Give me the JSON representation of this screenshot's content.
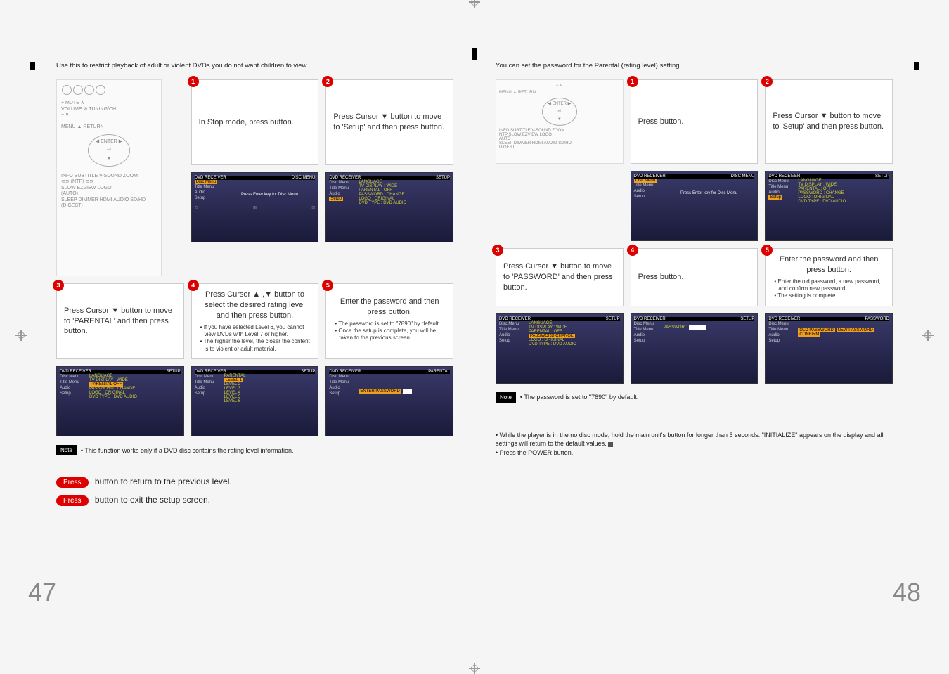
{
  "crosshair_glyph": "⊕",
  "left_page": {
    "intro": "Use this to restrict playback of adult or violent DVDs you do not want children to view.",
    "remote_labels": [
      "MUTE",
      "VOLUME",
      "TUNING/CH",
      "MENU",
      "ENTER",
      "RETURN",
      "INFO",
      "SUBTITLE",
      "V-SOUND",
      "ZOOM",
      "NTP",
      "SLOW",
      "EZVIEW",
      "LOGO",
      "AUTO",
      "SLEEP",
      "DIMMER",
      "HDMI AUDIO",
      "SD/HD",
      "DIGEST"
    ],
    "step1": "In Stop mode, press         button.",
    "step2": "Press Cursor ▼ button to move to 'Setup' and then press          button.",
    "step3": "Press Cursor ▼ button to move to 'PARENTAL' and then press          button.",
    "step4": "Press Cursor ▲ ,▼ button to select the desired rating level and then press           button.",
    "step4_notes": [
      "If you have selected Level 6, you cannot view DVDs with Level 7 or higher.",
      "The higher the level, the closer the content is to violent or adult material."
    ],
    "step5": "Enter the password and then press           button.",
    "step5_notes": [
      "The password is set to \"7890\" by default.",
      "Once the setup is complete, you will be taken to the previous screen."
    ],
    "osd_sidebar": [
      "Disc Menu",
      "Title Menu",
      "Audio",
      "Setup"
    ],
    "osd_press_enter": "Press Enter key for Disc Menu",
    "osd_setup_items": [
      "LANGUAGE",
      "TV DISPLAY     : WIDE",
      "PARENTAL       : OFF",
      "PASSWORD       : CHANGE",
      "LOGO           : ORIGINAL",
      "DVD TYPE       : DVD AUDIO"
    ],
    "osd_parental_hl": "PARENTAL      OFF",
    "osd_levels_header": "PARENTAL",
    "osd_levels": [
      "LEVEL 1",
      "LEVEL 2",
      "LEVEL 3",
      "LEVEL 4",
      "LEVEL 5",
      "LEVEL 6"
    ],
    "osd_password_header": "PARENTAL",
    "osd_enter_password": "ENTER PASSWORD",
    "note_label": "Note",
    "note_text": "• This function works only if a DVD disc contains the rating level information.",
    "footer1_pill": "Press",
    "footer1": "button to return to the previous level.",
    "footer2_pill": "Press",
    "footer2": "button to exit the setup screen.",
    "page_number": "47"
  },
  "right_page": {
    "intro": "You can set the password for the Parental (rating level) setting.",
    "remote_labels": [
      "MENU",
      "ENTER",
      "RETURN",
      "INFO",
      "SUBTITLE",
      "V-SOUND",
      "ZOOM",
      "NTP",
      "SLOW",
      "EZVIEW",
      "LOGO",
      "AUTO",
      "SLEEP",
      "DIMMER",
      "HDMI AUDIO",
      "SD/HD",
      "DIGEST"
    ],
    "step1": "Press          button.",
    "step2": "Press Cursor ▼ button to move to 'Setup' and then press          button.",
    "step3": "Press Cursor ▼ button to move to 'PASSWORD' and then press           button.",
    "step4": "Press          button.",
    "step5": "Enter the password and then press           button.",
    "step5_notes": [
      "Enter the old password, a new password, and confirm new password.",
      "The setting is complete."
    ],
    "osd_sidebar": [
      "Disc Menu",
      "Title Menu",
      "Audio",
      "Setup"
    ],
    "osd_press_enter": "Press Enter key for Disc Menu",
    "osd_setup_items": [
      "LANGUAGE",
      "TV DISPLAY     : WIDE",
      "PARENTAL       : OFF",
      "PASSWORD       : CHANGE",
      "LOGO           : ORIGINAL",
      "DVD TYPE       : DVD AUDIO"
    ],
    "osd_password_hl": "PASSWORD      CHANGE",
    "osd_password_entry_header": "SETUP",
    "osd_password_entry_label": "PASSWORD",
    "osd_change_header": "PASSWORD",
    "osd_change_rows": [
      "OLD PASSWORD",
      "NEW PASSWORD",
      "CONFIRM"
    ],
    "note_label": "Note",
    "note_text": "• The password is set to \"7890\" by default.",
    "restore1": "While the player is in the no disc mode, hold the main unit's      button for longer than 5 seconds. \"INITIALIZE\" appears on the display and all settings will return to the default values.",
    "restore2": "Press the POWER button.",
    "page_number": "48"
  }
}
